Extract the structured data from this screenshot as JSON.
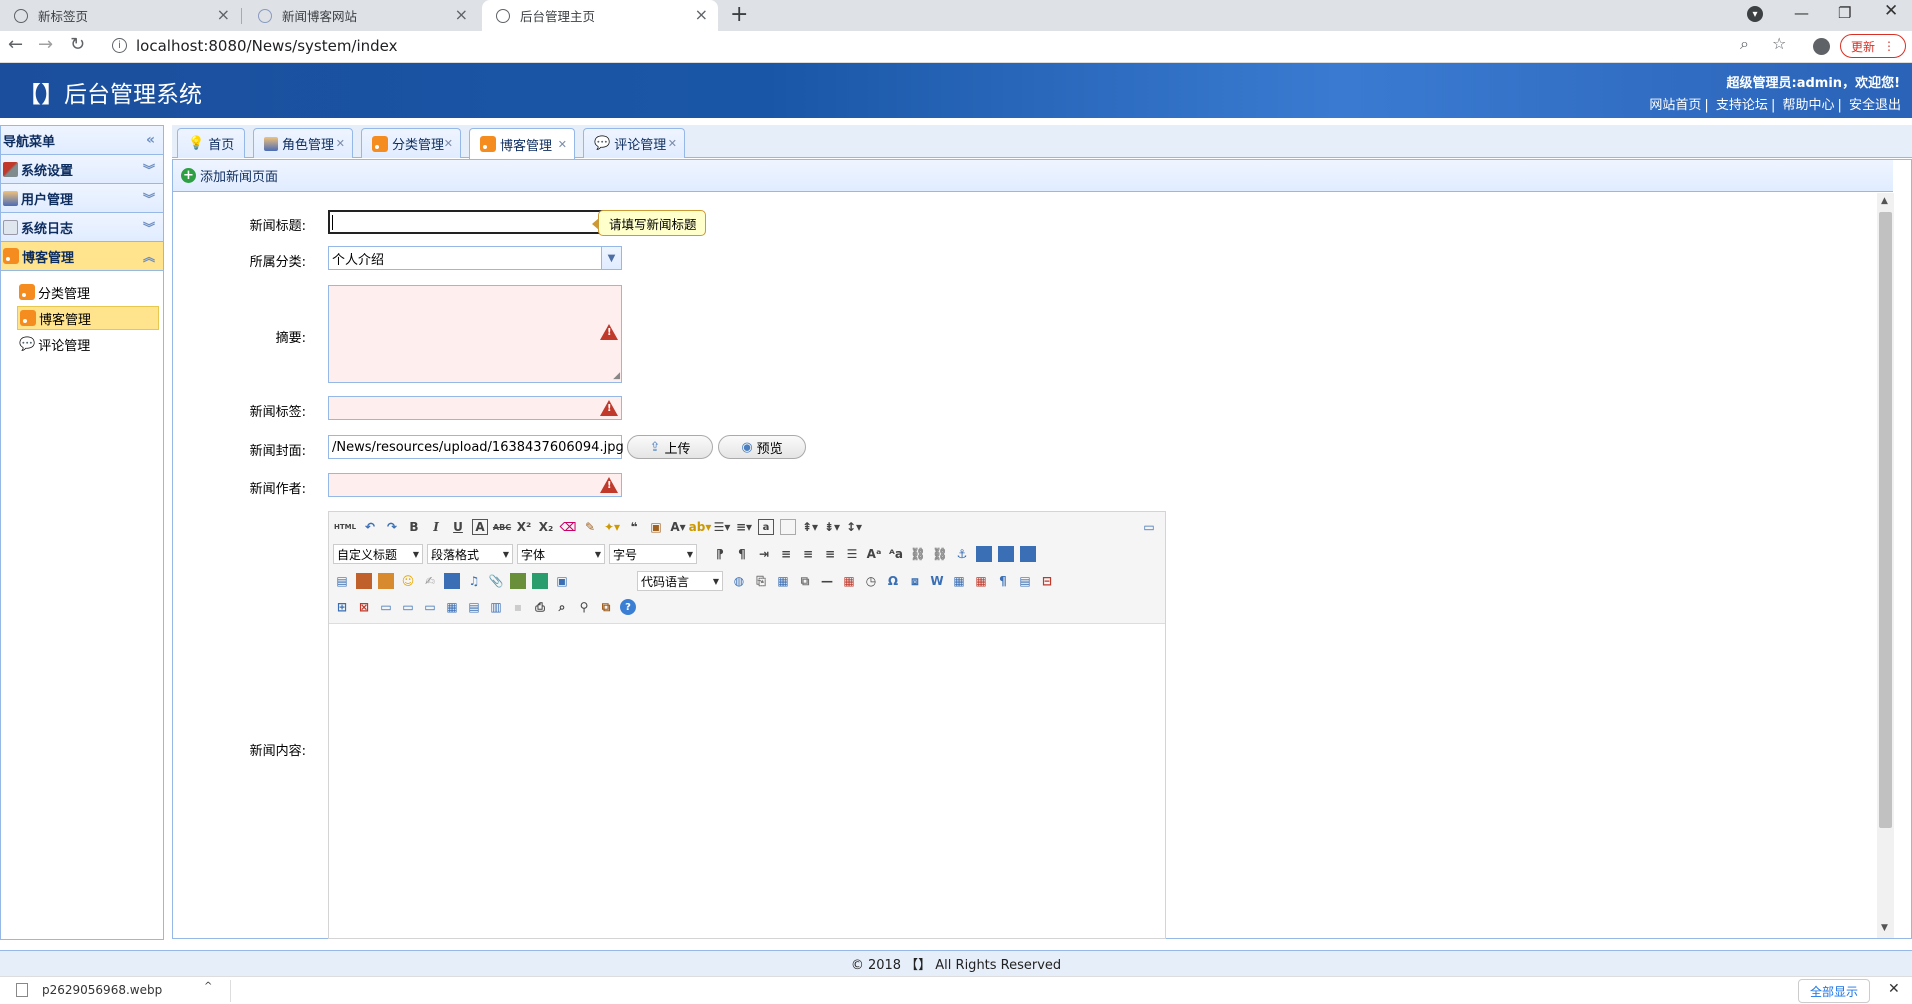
{
  "browser": {
    "tabs": [
      {
        "title": "新标签页",
        "active": false
      },
      {
        "title": "新闻博客网站",
        "active": false
      },
      {
        "title": "后台管理主页",
        "active": true
      }
    ],
    "url": "localhost:8080/News/system/index",
    "update_label": "更新",
    "download_file": "p2629056968.webp",
    "download_all": "全部显示"
  },
  "header": {
    "title": "【】后台管理系统",
    "welcome": "超级管理员:admin，欢迎您!",
    "links": [
      "网站首页",
      "支持论坛",
      "帮助中心",
      "安全退出"
    ]
  },
  "nav": {
    "title": "导航菜单",
    "sections": [
      {
        "label": "系统设置",
        "icon": "tools-icon"
      },
      {
        "label": "用户管理",
        "icon": "users-icon"
      },
      {
        "label": "系统日志",
        "icon": "log-icon"
      },
      {
        "label": "博客管理",
        "icon": "rss-icon"
      }
    ],
    "items": [
      {
        "label": "分类管理"
      },
      {
        "label": "博客管理"
      },
      {
        "label": "评论管理"
      }
    ]
  },
  "tabs": [
    {
      "label": "首页"
    },
    {
      "label": "角色管理"
    },
    {
      "label": "分类管理"
    },
    {
      "label": "博客管理"
    },
    {
      "label": "评论管理"
    }
  ],
  "panel": {
    "title": "添加新闻页面"
  },
  "form": {
    "title_label": "新闻标题:",
    "title_value": "",
    "title_tooltip": "请填写新闻标题",
    "category_label": "所属分类:",
    "category_value": "个人介绍",
    "summary_label": "摘要:",
    "tags_label": "新闻标签:",
    "cover_label": "新闻封面:",
    "cover_value": "/News/resources/upload/1638437606094.jpg",
    "upload_label": "上传",
    "preview_label": "预览",
    "author_label": "新闻作者:",
    "content_label": "新闻内容:"
  },
  "editor": {
    "heading_combo": "自定义标题",
    "paragraph_combo": "段落格式",
    "font_combo": "字体",
    "size_combo": "字号",
    "code_combo": "代码语言"
  },
  "footer": {
    "text": "© 2018 【】 All Rights Reserved"
  }
}
